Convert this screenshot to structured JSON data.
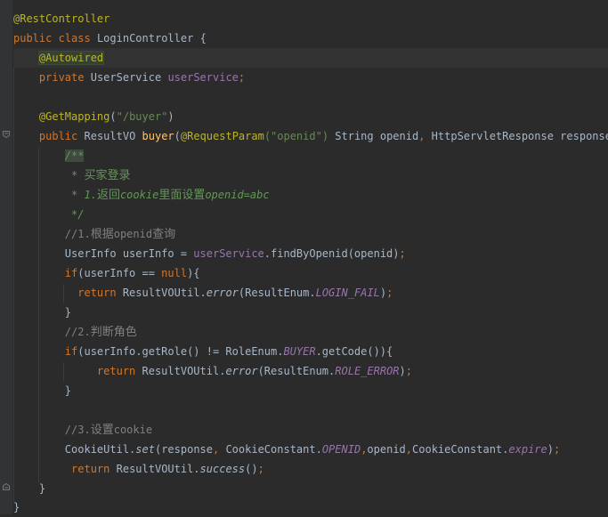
{
  "code": {
    "line1": {
      "annotation": "@RestController"
    },
    "line2": {
      "kw_public": "public",
      "kw_class": "class",
      "class_name": "LoginController",
      "brace": "{"
    },
    "line3": {
      "annotation": "@Autowired"
    },
    "line4": {
      "kw_private": "private",
      "type": "UserService",
      "field": "userService",
      "semicolon": ";"
    },
    "line6": {
      "annotation": "@GetMapping",
      "paren_open": "(",
      "string": "\"/buyer\"",
      "paren_close": ")"
    },
    "line7": {
      "kw_public": "public",
      "type": "ResultVO",
      "method": "buyer",
      "paren": "(",
      "annotation": "@RequestParam",
      "string_part": "(\"openid\")",
      "param1": " String openid",
      "comma1": ",",
      "param2": " HttpServletResponse response",
      "end": "){"
    },
    "line8": {
      "doc_open": "/**"
    },
    "line9": {
      "star": "* ",
      "text": "买家登录"
    },
    "line10": {
      "star_num": "* 1.",
      "t1": "返回",
      "t2": "cookie",
      "t3": "里面设置",
      "t4": "openid=abc"
    },
    "line11": {
      "doc_close": "*/"
    },
    "line12": {
      "prefix": "//1.",
      "cjk": "根据",
      "suffix": "openid",
      "cjk2": "查询"
    },
    "line13": {
      "type": "UserInfo",
      "decl": " userInfo = ",
      "field": "userService",
      "call": ".findByOpenid(openid)",
      "semicolon": ";"
    },
    "line14": {
      "kw_if": "if",
      "cond": "(userInfo == ",
      "kw_null": "null",
      "end": "){"
    },
    "line15": {
      "kw_return": "return",
      "cls": " ResultVOUtil.",
      "method": "error",
      "open": "(ResultEnum.",
      "const": "LOGIN_FAIL",
      "close": ")",
      "semicolon": ";"
    },
    "line16": {
      "brace": "}"
    },
    "line17": {
      "prefix": "//2.",
      "cjk": "判断角色"
    },
    "line18": {
      "kw_if": "if",
      "cond": "(userInfo.getRole() != RoleEnum.",
      "const": "BUYER",
      "end": ".getCode()){"
    },
    "line19": {
      "kw_return": "return",
      "cls": " ResultVOUtil.",
      "method": "error",
      "open": "(ResultEnum.",
      "const": "ROLE_ERROR",
      "close": ")",
      "semicolon": ";"
    },
    "line20": {
      "brace": "}"
    },
    "line22": {
      "prefix": "//3.",
      "cjk": "设置",
      "suffix": "cookie"
    },
    "line23": {
      "cls": "CookieUtil.",
      "method": "set",
      "args1": "(response",
      "comma1": ",",
      "args2": " CookieConstant.",
      "const1": "OPENID",
      "comma2": ",",
      "args3": "openid",
      "comma3": ",",
      "args4": "CookieConstant.",
      "const2": "expire",
      "close": ")",
      "semicolon": ";"
    },
    "line24": {
      "kw_return": "return",
      "cls": " ResultVOUtil.",
      "method": "success",
      "call": "()",
      "semicolon": ";"
    },
    "line25": {
      "brace": "}"
    },
    "line26": {
      "brace": "}"
    }
  },
  "colors": {
    "background": "#2b2b2b",
    "gutter": "#313335",
    "keyword": "#cc7832",
    "annotation": "#bbb529",
    "string": "#6a8759",
    "field": "#9876aa",
    "method_decl": "#ffc66d",
    "comment": "#808080",
    "doc_comment": "#629755",
    "text": "#a9b7c6"
  },
  "icons": [
    "fold-icon",
    "unfold-icon"
  ]
}
